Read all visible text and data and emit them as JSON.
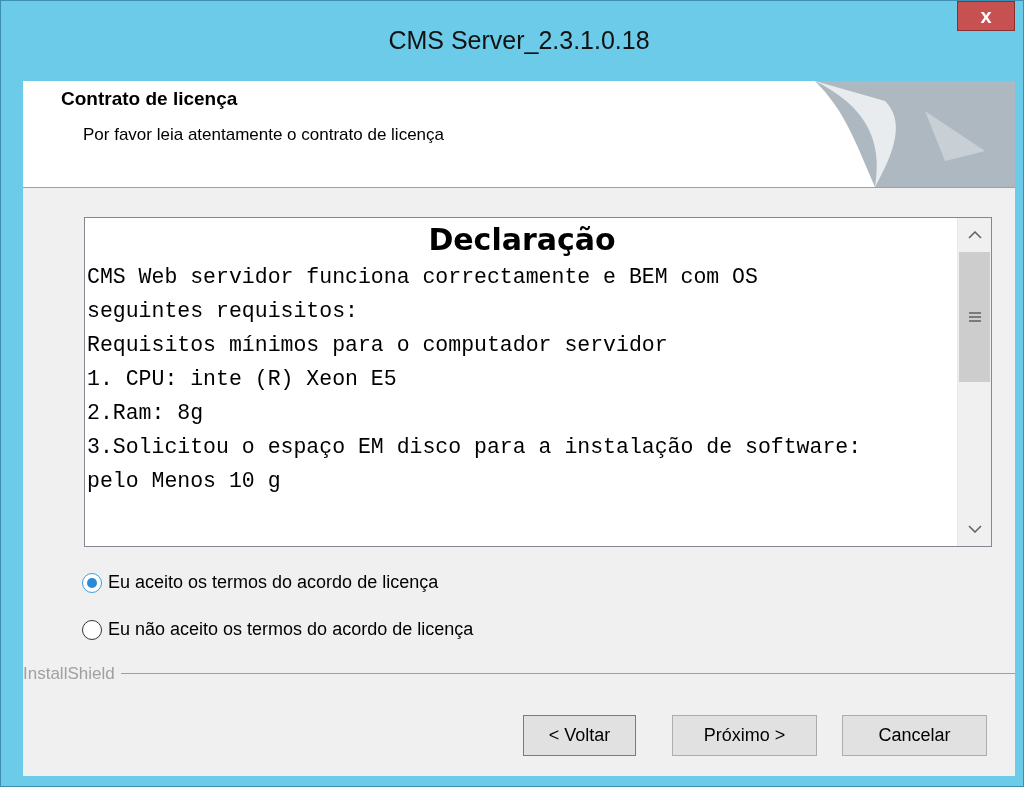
{
  "window": {
    "title": "CMS Server_2.3.1.0.18",
    "close": "x"
  },
  "header": {
    "title": "Contrato de licença",
    "subtitle": "Por favor leia atentamente o contrato de licença"
  },
  "license": {
    "heading": "Declaração",
    "lines": [
      "CMS Web servidor funciona correctamente e BEM com OS",
      "seguintes requisitos:",
      "Requisitos mínimos para o computador servidor",
      "1. CPU: inte (R) Xeon E5",
      "2.Ram: 8g",
      "3.Solicitou o espaço EM disco para a instalação de software:",
      "pelo Menos 10 g"
    ]
  },
  "options": [
    {
      "label": "Eu aceito os termos do acordo de licença",
      "selected": true
    },
    {
      "label": "Eu não aceito os termos do acordo de licença",
      "selected": false
    }
  ],
  "brand": "InstallShield",
  "buttons": [
    {
      "label": "< Voltar",
      "focused": true
    },
    {
      "label": "Próximo >",
      "focused": false
    },
    {
      "label": "Cancelar",
      "focused": false
    }
  ]
}
